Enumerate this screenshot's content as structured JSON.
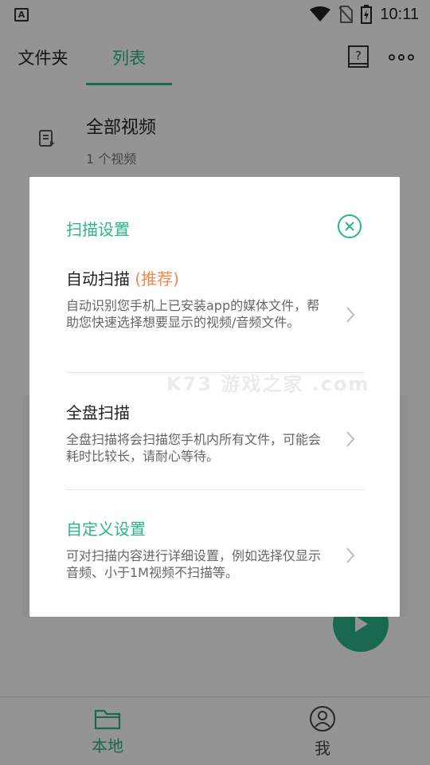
{
  "status_bar": {
    "time": "10:11",
    "app_icon_letter": "A"
  },
  "header": {
    "tabs": [
      {
        "label": "文件夹",
        "active": false
      },
      {
        "label": "列表",
        "active": true
      }
    ],
    "help_icon_label": "?"
  },
  "list": {
    "items": [
      {
        "title": "全部视频",
        "subtitle": "1 个视频"
      }
    ]
  },
  "dialog": {
    "title": "扫描设置",
    "options": [
      {
        "title": "自动扫描",
        "tag": "(推荐)",
        "description": "自动识别您手机上已安装app的媒体文件，帮助您快速选择想要显示的视频/音频文件。"
      },
      {
        "title": "全盘扫描",
        "description": "全盘扫描将会扫描您手机内所有文件，可能会耗时比较长，请耐心等待。"
      },
      {
        "title": "自定义设置",
        "description": "可对扫描内容进行详细设置，例如选择仅显示音频、小于1M视频不扫描等。"
      }
    ],
    "watermark": "K73 游戏之家 .com"
  },
  "bottom_nav": {
    "items": [
      {
        "label": "本地",
        "icon": "folder-icon",
        "active": true
      },
      {
        "label": "我",
        "icon": "person-icon",
        "active": false
      }
    ]
  },
  "colors": {
    "accent": "#2bb58a",
    "tag": "#f08a4b"
  }
}
